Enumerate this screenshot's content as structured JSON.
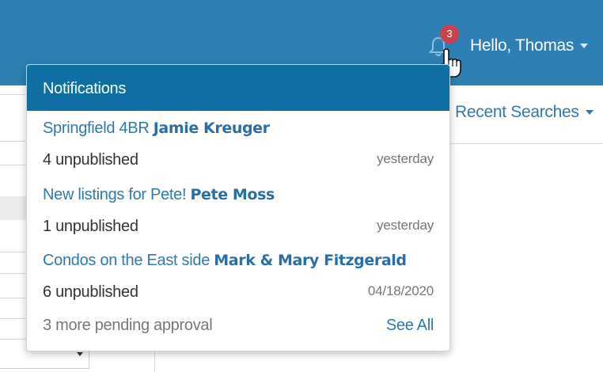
{
  "header": {
    "greeting": "Hello, Thomas",
    "notification_count": "3",
    "bell_icon": "bell-icon",
    "cursor_icon": "hand-pointer-icon"
  },
  "page": {
    "recent_searches_label": "Recent Searches"
  },
  "notifications": {
    "title": "Notifications",
    "items": [
      {
        "search_name": "Springfield 4BR",
        "client": "Jamie Kreuger",
        "count_text": "4 unpublished",
        "time": "yesterday"
      },
      {
        "search_name": "New listings for Pete!",
        "client": "Pete Moss",
        "count_text": "1 unpublished",
        "time": "yesterday"
      },
      {
        "search_name": "Condos on the East side",
        "client": "Mark & Mary Fitzgerald",
        "count_text": "6 unpublished",
        "time": "04/18/2020"
      }
    ],
    "pending_text": "3 more pending approval",
    "see_all_label": "See All"
  },
  "colors": {
    "topbar": "#2e7fb3",
    "dropdown_header": "#0f6fa3",
    "link": "#2f79b0",
    "badge": "#c9414a"
  }
}
